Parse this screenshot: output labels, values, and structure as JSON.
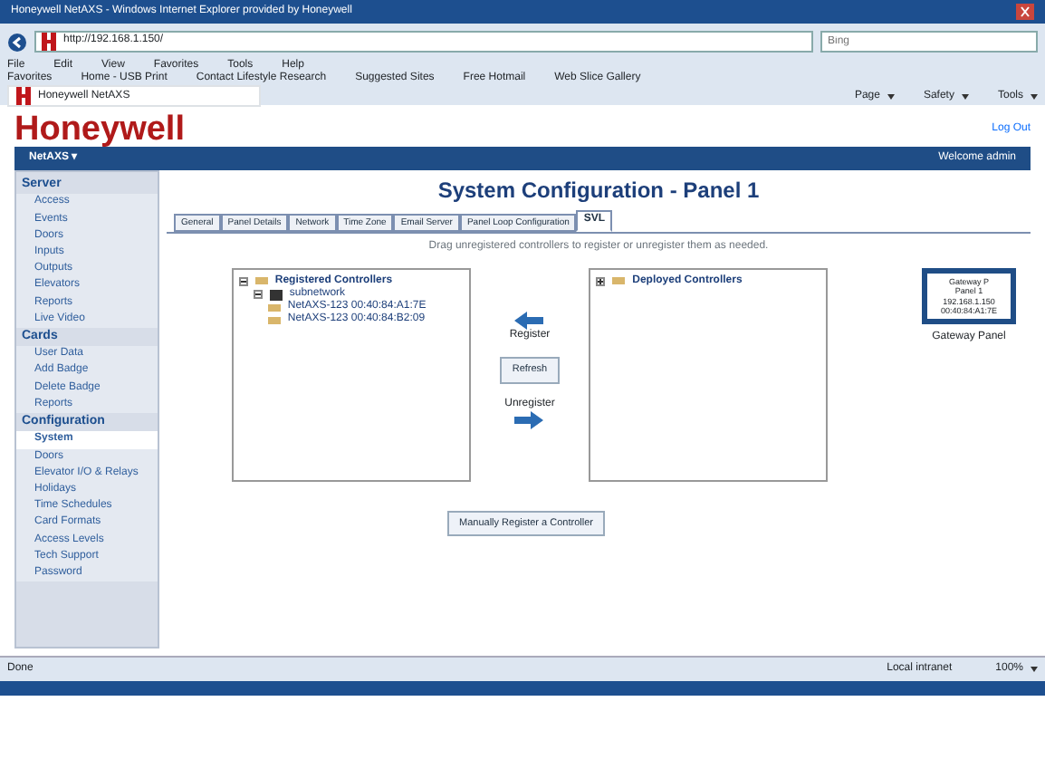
{
  "window": {
    "title": "Honeywell NetAXS - Windows Internet Explorer provided by Honeywell"
  },
  "address_bar": {
    "value": "http://192.168.1.150/",
    "search_placeholder": "Bing"
  },
  "menu_bar": [
    "File",
    "Edit",
    "View",
    "Favorites",
    "Tools",
    "Help"
  ],
  "favorites_bar": [
    "Favorites",
    "Home - USB Print",
    "Contact Lifestyle Research",
    "Suggested Sites",
    "Free Hotmail",
    "Web Slice Gallery"
  ],
  "browser_tab": {
    "title": "Honeywell NetAXS"
  },
  "command_bar": [
    "Page",
    "Safety",
    "Tools"
  ],
  "header": {
    "logo": "Honeywell",
    "logout": "Log Out"
  },
  "nav": {
    "product": "NetAXS ▾",
    "right": "Welcome admin"
  },
  "sidebar": [
    {
      "heading": "Server",
      "items": [
        {
          "label": "Access",
          "selected": false
        },
        {
          "label": "Events",
          "selected": false
        },
        {
          "label": "Doors",
          "selected": false
        },
        {
          "label": "Inputs",
          "selected": false
        },
        {
          "label": "Outputs",
          "selected": false
        },
        {
          "label": "Elevators",
          "selected": false
        },
        {
          "label": "Reports",
          "selected": false
        },
        {
          "label": "Live Video",
          "selected": false
        }
      ]
    },
    {
      "heading": "Cards",
      "items": [
        {
          "label": "User Data",
          "selected": false
        },
        {
          "label": "Add Badge",
          "selected": false
        },
        {
          "label": "Delete Badge",
          "selected": false
        },
        {
          "label": "Reports",
          "selected": false
        }
      ]
    },
    {
      "heading": "Configuration",
      "items": [
        {
          "label": "System",
          "selected": true
        },
        {
          "label": "Doors",
          "selected": false
        },
        {
          "label": "Elevator I/O & Relays",
          "selected": false
        },
        {
          "label": "Holidays",
          "selected": false
        },
        {
          "label": "Time Schedules",
          "selected": false
        },
        {
          "label": "Card Formats",
          "selected": false
        },
        {
          "label": "Access Levels",
          "selected": false
        },
        {
          "label": "Tech Support",
          "selected": false
        },
        {
          "label": "Password",
          "selected": false
        }
      ]
    }
  ],
  "page": {
    "title": "System Configuration - Panel 1",
    "tabs": [
      {
        "label": "General",
        "selected": false
      },
      {
        "label": "Panel Details",
        "selected": false
      },
      {
        "label": "Network",
        "selected": false
      },
      {
        "label": "Time Zone",
        "selected": false
      },
      {
        "label": "Email Server",
        "selected": false
      },
      {
        "label": "Panel Loop Configuration",
        "selected": false
      },
      {
        "label": "SVL",
        "selected": true
      }
    ],
    "hint": "Drag unregistered controllers to register or unregister them as needed.",
    "registered_tree": {
      "label": "Registered Controllers",
      "expanded": true,
      "children": [
        {
          "label": "subnetwork",
          "expanded": true,
          "children": [
            {
              "label": "NetAXS-123 00:40:84:A1:7E"
            },
            {
              "label": "NetAXS-123 00:40:84:B2:09"
            }
          ]
        }
      ]
    },
    "register_label": "Register",
    "refresh": "Refresh",
    "unregister_label": "Unregister",
    "deployed_tree": {
      "label": "Deployed Controllers",
      "expanded": false
    },
    "manual_button": "Manually Register a Controller",
    "gateway": {
      "lines": [
        "Gateway P",
        "Panel 1",
        "192.168.1.150",
        "00:40:84:A1:7E"
      ],
      "caption": "Gateway Panel"
    }
  },
  "status_bar": {
    "left": "Done",
    "zone": "Local intranet",
    "zoom": "100%"
  }
}
